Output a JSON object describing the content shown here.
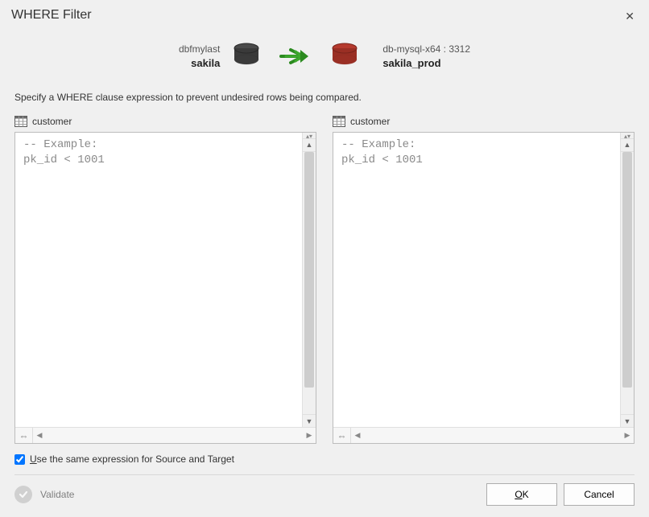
{
  "title": "WHERE Filter",
  "close_label": "✕",
  "source": {
    "host": "dbfmylast",
    "db": "sakila",
    "table": "customer",
    "placeholder": "-- Example:\npk_id < 1001"
  },
  "target": {
    "host": "db-mysql-x64 : 3312",
    "db": "sakila_prod",
    "table": "customer",
    "placeholder": "-- Example:\npk_id < 1001"
  },
  "instruction": "Specify a WHERE clause expression to prevent undesired rows being compared.",
  "use_same_label_pre": "U",
  "use_same_label_rest": "se the same expression for Source and Target",
  "use_same_checked": true,
  "validate_label": "Validate",
  "ok_label_pre": "O",
  "ok_label_rest": "K",
  "cancel_label": "Cancel"
}
